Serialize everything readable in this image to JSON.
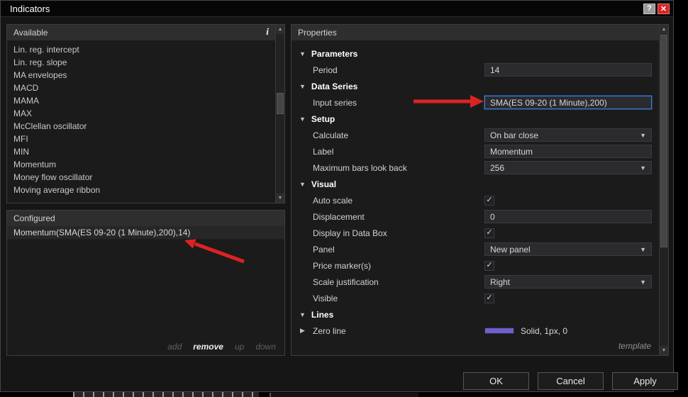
{
  "dialog": {
    "title": "Indicators",
    "help_label": "?",
    "close_label": "✕"
  },
  "icons": {
    "info": "i",
    "check": "✓",
    "chevron_down": "▼",
    "expand_right": "▶",
    "scroll_up": "▲",
    "scroll_down": "▼"
  },
  "colors": {
    "accent_red": "#dc2322",
    "highlight_border": "#3b7bd6",
    "header_bg": "#2e2e2e",
    "dialog_bg": "#161616",
    "field_bg": "#2b2b2f",
    "zero_line_swatch": "#6e5fd0"
  },
  "available": {
    "header": "Available",
    "items": [
      "Lin. reg. intercept",
      "Lin. reg. slope",
      "MA envelopes",
      "MACD",
      "MAMA",
      "MAX",
      "McClellan oscillator",
      "MFI",
      "MIN",
      "Momentum",
      "Money flow oscillator",
      "Moving average ribbon"
    ]
  },
  "configured": {
    "header": "Configured",
    "items": [
      "Momentum(SMA(ES 09-20 (1 Minute),200),14)"
    ],
    "actions": [
      {
        "label": "add",
        "enabled": false
      },
      {
        "label": "remove",
        "enabled": true
      },
      {
        "label": "up",
        "enabled": false
      },
      {
        "label": "down",
        "enabled": false
      }
    ]
  },
  "properties": {
    "header": "Properties",
    "template_label": "template",
    "groups": [
      {
        "label": "Parameters",
        "expanded": true,
        "rows": [
          {
            "label": "Period",
            "type": "text",
            "value": "14"
          }
        ]
      },
      {
        "label": "Data Series",
        "expanded": true,
        "rows": [
          {
            "label": "Input series",
            "type": "text",
            "value": "SMA(ES 09-20 (1 Minute),200)",
            "highlighted": true
          }
        ]
      },
      {
        "label": "Setup",
        "expanded": true,
        "rows": [
          {
            "label": "Calculate",
            "type": "select",
            "value": "On bar close"
          },
          {
            "label": "Label",
            "type": "text",
            "value": "Momentum"
          },
          {
            "label": "Maximum bars look back",
            "type": "select",
            "value": "256"
          }
        ]
      },
      {
        "label": "Visual",
        "expanded": true,
        "rows": [
          {
            "label": "Auto scale",
            "type": "checkbox",
            "checked": true
          },
          {
            "label": "Displacement",
            "type": "text",
            "value": "0"
          },
          {
            "label": "Display in Data Box",
            "type": "checkbox",
            "checked": true
          },
          {
            "label": "Panel",
            "type": "select",
            "value": "New panel"
          },
          {
            "label": "Price marker(s)",
            "type": "checkbox",
            "checked": true
          },
          {
            "label": "Scale justification",
            "type": "select",
            "value": "Right"
          },
          {
            "label": "Visible",
            "type": "checkbox",
            "checked": true
          }
        ]
      },
      {
        "label": "Lines",
        "expanded": true,
        "rows": [
          {
            "label": "Zero line",
            "type": "line",
            "value": "Solid, 1px, 0",
            "swatch_color": "#6e5fd0",
            "expander": true
          }
        ]
      }
    ]
  },
  "footer": {
    "ok": "OK",
    "cancel": "Cancel",
    "apply": "Apply"
  }
}
